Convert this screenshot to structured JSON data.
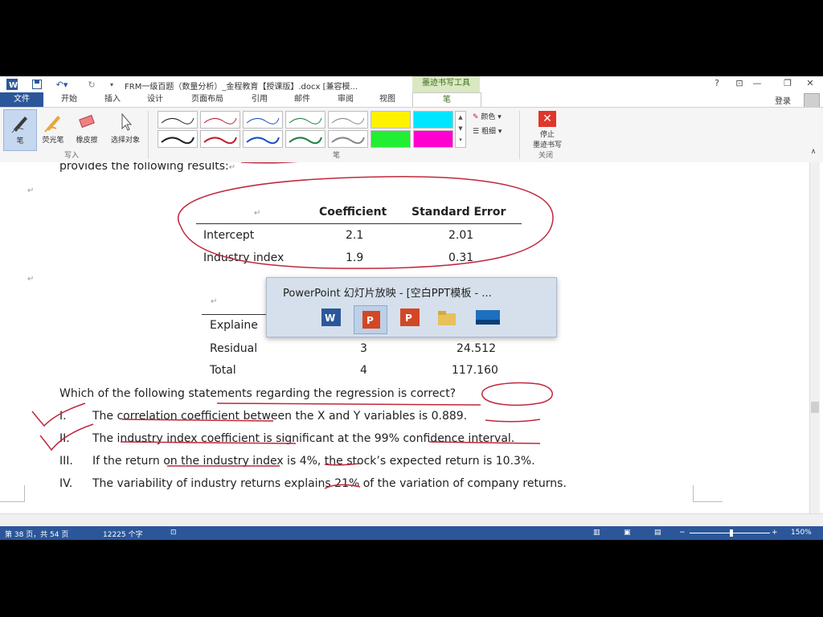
{
  "titlebar": {
    "document_title": "FRM一级百题（数量分析）_金程教育【授课版】.docx [兼容模...",
    "tool_context": "墨迹书写工具",
    "help": "?"
  },
  "tabs": {
    "file": "文件",
    "items": [
      "开始",
      "插入",
      "设计",
      "页面布局",
      "引用",
      "邮件",
      "审阅",
      "视图"
    ],
    "active": "笔",
    "login": "登录"
  },
  "ribbon": {
    "write_buttons": [
      "笔",
      "荧光笔",
      "橡皮擦",
      "选择对象"
    ],
    "write_group": "写入",
    "pen_group": "笔",
    "color_label": "颜色",
    "thickness_label": "粗细",
    "stop_label_1": "停止",
    "stop_label_2": "墨迹书写",
    "close_group": "关闭"
  },
  "document": {
    "intro_line": "provides the following results:",
    "table1": {
      "headers": [
        "Coefficient",
        "Standard Error"
      ],
      "rows": [
        {
          "label": "Intercept",
          "coef": "2.1",
          "se": "2.01"
        },
        {
          "label": "Industry index",
          "coef": "1.9",
          "se": "0.31"
        }
      ]
    },
    "table2": {
      "rows": [
        {
          "label": "Explaine",
          "df": "",
          "val": ""
        },
        {
          "label": "Residual",
          "df": "3",
          "val": "24.512"
        },
        {
          "label": "Total",
          "df": "4",
          "val": "117.160"
        }
      ]
    },
    "question": "Which of the following statements regarding the regression is correct?",
    "options": [
      {
        "num": "I.",
        "text": "The correlation coefficient between the X and Y variables is 0.889."
      },
      {
        "num": "II.",
        "text": "The industry index coefficient is significant at the 99% confidence interval."
      },
      {
        "num": "III.",
        "text": "If the return on the industry index is 4%, the stock’s expected return is 10.3%."
      },
      {
        "num": "IV.",
        "text": "The variability of industry returns explains 21% of the variation of company returns."
      }
    ]
  },
  "popup": {
    "title": "PowerPoint 幻灯片放映 - [空白PPT模板 - ..."
  },
  "status": {
    "page": "第 38 页，共 54 页",
    "words": "12225 个字",
    "zoom": "150%"
  },
  "colors": {
    "word_blue": "#2b579a",
    "ink_red": "#c0283c",
    "ribbon_bg": "#f5f5f5",
    "tool_green": "#d9e8c2"
  }
}
